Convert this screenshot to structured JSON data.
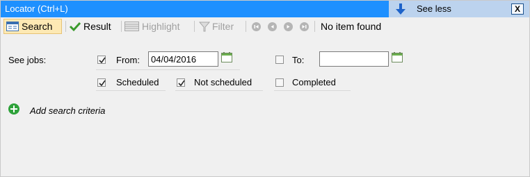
{
  "titlebar": {
    "title": "Locator (Ctrl+L)",
    "see_less_label": "See less",
    "close_label": "X"
  },
  "toolbar": {
    "search_label": "Search",
    "result_label": "Result",
    "highlight_label": "Highlight",
    "filter_label": "Filter",
    "status_text": "No item found"
  },
  "filters": {
    "see_jobs_label": "See jobs:",
    "from_label": "From:",
    "from_value": "04/04/2016",
    "from_checked": true,
    "to_label": "To:",
    "to_value": "",
    "to_checked": false,
    "scheduled_label": "Scheduled",
    "scheduled_checked": true,
    "not_scheduled_label": "Not scheduled",
    "not_scheduled_checked": true,
    "completed_label": "Completed",
    "completed_checked": false
  },
  "criteria": {
    "add_label": "Add search criteria"
  },
  "colors": {
    "title_bar": "#1e90ff",
    "see_less_bg": "#bcd3ee",
    "active_tab": "#fde9b4",
    "add_icon": "#2ea23a"
  }
}
